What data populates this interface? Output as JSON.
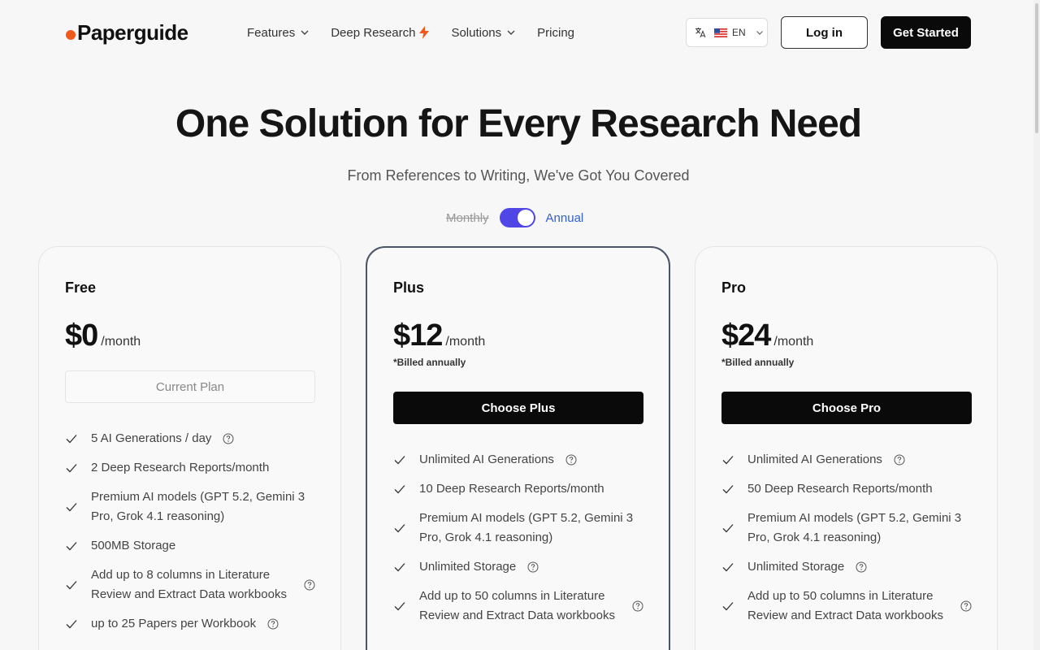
{
  "header": {
    "logo": "Paperguide",
    "nav": [
      {
        "label": "Features",
        "icon": "chevron-down-icon"
      },
      {
        "label": "Deep Research",
        "icon": "bolt-icon"
      },
      {
        "label": "Solutions",
        "icon": "chevron-down-icon"
      },
      {
        "label": "Pricing",
        "icon": ""
      }
    ],
    "language": {
      "code": "EN",
      "flag": "us-flag-icon"
    },
    "login_label": "Log in",
    "get_started_label": "Get Started"
  },
  "hero": {
    "title": "One Solution for Every Research Need",
    "subtitle": "From References to Writing, We've Got You Covered"
  },
  "billing": {
    "monthly_label": "Monthly",
    "annual_label": "Annual",
    "annual_selected": true
  },
  "plans": [
    {
      "name": "Free",
      "price": "$0",
      "period": "/month",
      "billed_note": "",
      "button_label": "Current Plan",
      "features": [
        {
          "text": "5 AI Generations / day",
          "help": true
        },
        {
          "text": "2 Deep Research Reports/month",
          "help": false
        },
        {
          "text": "Premium AI models (GPT 5.2, Gemini 3 Pro, Grok 4.1 reasoning)",
          "help": false
        },
        {
          "text": "500MB Storage",
          "help": false
        },
        {
          "text": "Add up to 8 columns in Literature Review and Extract Data workbooks",
          "help": true
        },
        {
          "text": "up to 25 Papers per Workbook",
          "help": true
        }
      ]
    },
    {
      "name": "Plus",
      "price": "$12",
      "period": "/month",
      "billed_note": "*Billed annually",
      "button_label": "Choose Plus",
      "features": [
        {
          "text": "Unlimited AI Generations",
          "help": true
        },
        {
          "text": "10 Deep Research Reports/month",
          "help": false
        },
        {
          "text": "Premium AI models (GPT 5.2, Gemini 3 Pro, Grok 4.1 reasoning)",
          "help": false
        },
        {
          "text": "Unlimited Storage",
          "help": true
        },
        {
          "text": "Add up to 50 columns in Literature Review and Extract Data workbooks",
          "help": true
        }
      ]
    },
    {
      "name": "Pro",
      "price": "$24",
      "period": "/month",
      "billed_note": "*Billed annually",
      "button_label": "Choose Pro",
      "features": [
        {
          "text": "Unlimited AI Generations",
          "help": true
        },
        {
          "text": "50 Deep Research Reports/month",
          "help": false
        },
        {
          "text": "Premium AI models (GPT 5.2, Gemini 3 Pro, Grok 4.1 reasoning)",
          "help": false
        },
        {
          "text": "Unlimited Storage",
          "help": true
        },
        {
          "text": "Add up to 50 columns in Literature Review and Extract Data workbooks",
          "help": true
        }
      ]
    }
  ],
  "colors": {
    "accent": "#4f46e5",
    "logo_dot": "#f05a1a",
    "bolt": "#f05a1a",
    "annual_text": "#2f5fd0",
    "primary_button": "#0a0a0a"
  }
}
